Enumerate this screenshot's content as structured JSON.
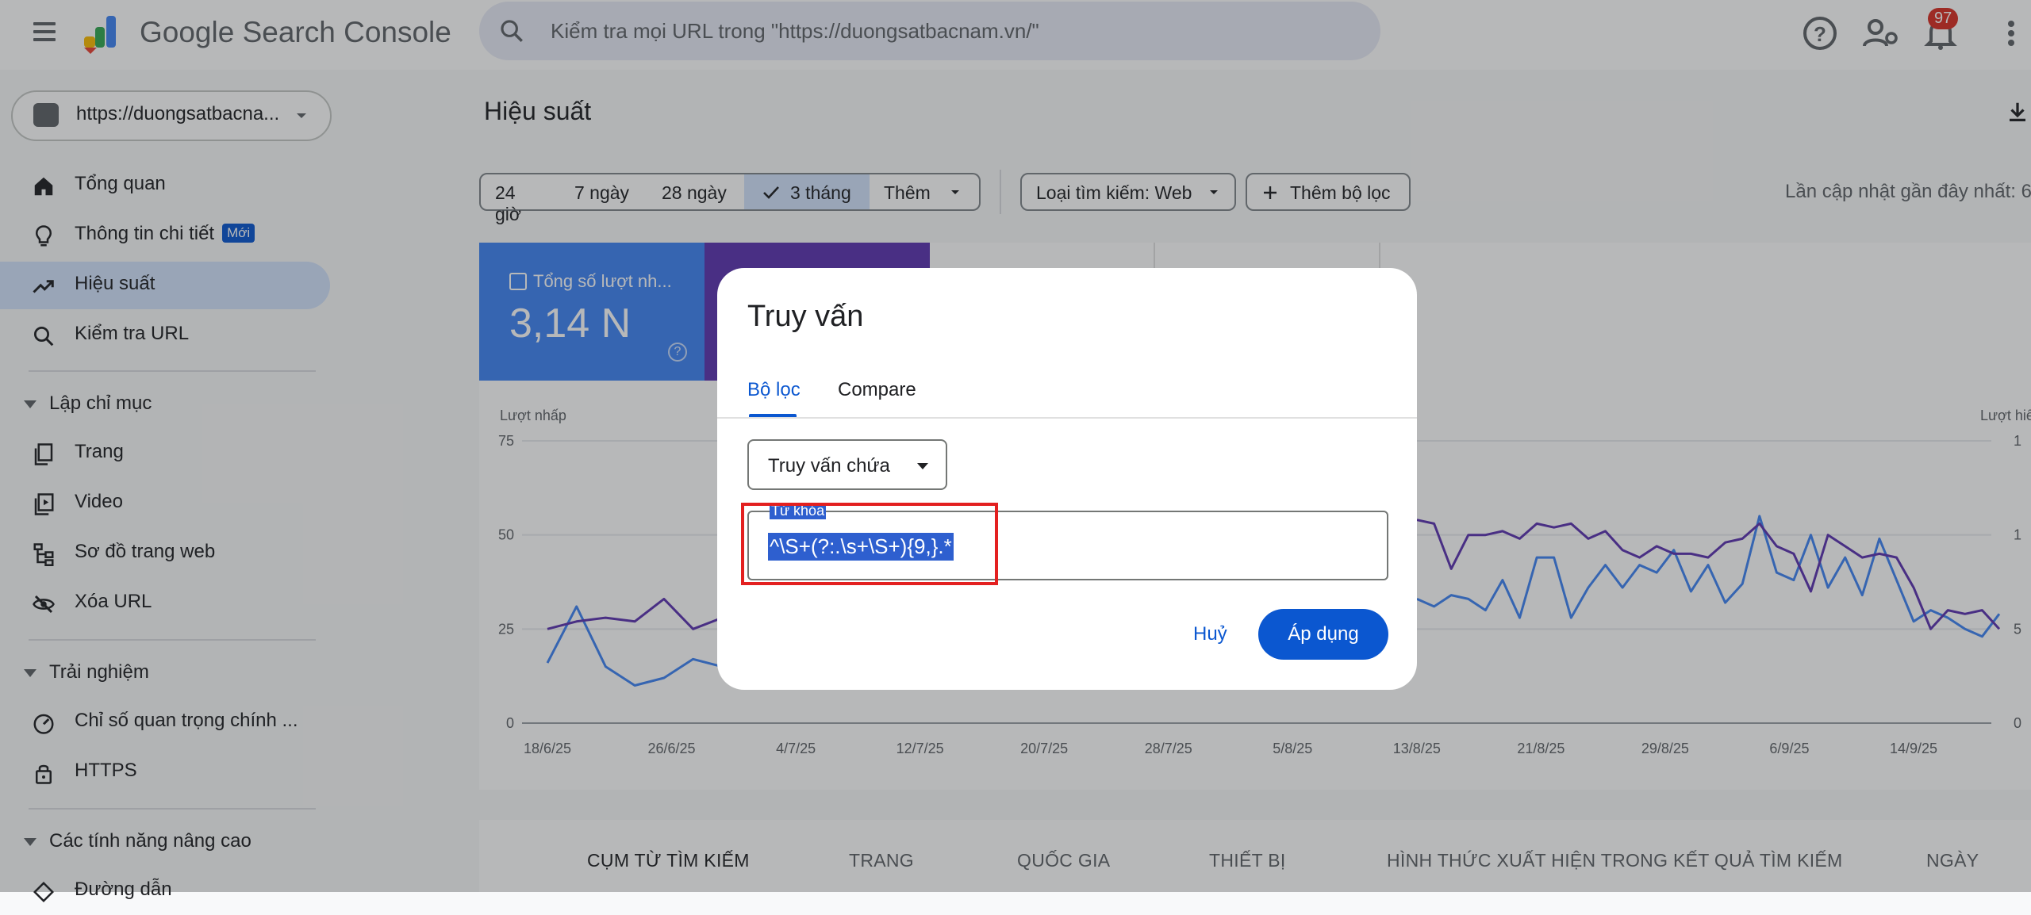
{
  "header": {
    "brand": "Google Search Console",
    "search_placeholder": "Kiểm tra mọi URL trong \"https://duongsatbacnam.vn/\"",
    "notification_count": "97"
  },
  "sidebar": {
    "property": "https://duongsatbacna...",
    "items": [
      {
        "label": "Tổng quan"
      },
      {
        "label": "Thông tin chi tiết",
        "badge": "Mới"
      },
      {
        "label": "Hiệu suất"
      },
      {
        "label": "Kiểm tra URL"
      }
    ],
    "sections": [
      {
        "label": "Lập chỉ mục",
        "items": [
          {
            "label": "Trang"
          },
          {
            "label": "Video"
          },
          {
            "label": "Sơ đồ trang web"
          },
          {
            "label": "Xóa URL"
          }
        ]
      },
      {
        "label": "Trải nghiệm",
        "items": [
          {
            "label": "Chỉ số quan trọng chính ..."
          },
          {
            "label": "HTTPS"
          }
        ]
      },
      {
        "label": "Các tính năng nâng cao",
        "items": [
          {
            "label": "Đường dẫn"
          }
        ]
      }
    ]
  },
  "main": {
    "title": "Hiệu suất",
    "date_chips": [
      "24 giờ",
      "7 ngày",
      "28 ngày",
      "3 tháng",
      "Thêm"
    ],
    "selected_chip": "3 tháng",
    "search_type": "Loại tìm kiếm: Web",
    "add_filter": "Thêm bộ lọc",
    "last_update": "Lần cập nhật gần đây nhất: 6",
    "card": {
      "label": "Tổng số lượt nh...",
      "value": "3,14 N"
    },
    "bottom_tabs": [
      "CỤM TỪ TÌM KIẾM",
      "TRANG",
      "QUỐC GIA",
      "THIẾT BỊ",
      "HÌNH THỨC XUẤT HIỆN TRONG KẾT QUẢ TÌM KIẾM",
      "NGÀY"
    ]
  },
  "chart_data": {
    "type": "line",
    "left_axis_label": "Lượt nhấp",
    "right_axis_label": "Lượt hiể",
    "y_ticks": [
      "0",
      "25",
      "50",
      "75"
    ],
    "right_ticks": [
      "0",
      "5",
      "1",
      "1"
    ],
    "x_ticks": [
      "18/6/25",
      "26/6/25",
      "4/7/25",
      "12/7/25",
      "20/7/25",
      "28/7/25",
      "5/8/25",
      "13/8/25",
      "21/8/25",
      "29/8/25",
      "6/9/25",
      "14/9/25"
    ],
    "ylim": [
      0,
      75
    ],
    "series": [
      {
        "color": "#4285f4",
        "values": [
          16,
          31,
          15,
          10,
          12,
          17,
          15,
          14,
          15,
          20,
          12,
          10,
          12,
          17,
          18
        ]
      },
      {
        "color": "#5e35b1",
        "values": [
          25,
          27,
          28,
          27,
          33,
          25,
          28,
          22,
          27,
          49,
          38,
          35,
          30,
          28,
          26
        ]
      },
      {
        "color": "#4285f4",
        "values": [
          33,
          31,
          34,
          33,
          30,
          38,
          28,
          44,
          44,
          28,
          36,
          42,
          36,
          42,
          40,
          46,
          35,
          42,
          32,
          37,
          55,
          40,
          38,
          50,
          36,
          44,
          34,
          49,
          38,
          27,
          30,
          28,
          25,
          23,
          29
        ]
      },
      {
        "color": "#5e35b1",
        "values": [
          54,
          53,
          41,
          50,
          50,
          51,
          49,
          53,
          52,
          53,
          49,
          51,
          46,
          44,
          47,
          45,
          45,
          44,
          48,
          49,
          53,
          47,
          45,
          35,
          50,
          47,
          44,
          45,
          44,
          36,
          25,
          30,
          29,
          30,
          25
        ]
      }
    ]
  },
  "dialog": {
    "title": "Truy vấn",
    "tabs": [
      "Bộ lọc",
      "Compare"
    ],
    "operator": "Truy vấn chứa",
    "field_label": "Từ khóa",
    "field_value": "^\\S+(?:.\\s+\\S+){9,}.*",
    "cancel": "Huỷ",
    "apply": "Áp dụng"
  }
}
